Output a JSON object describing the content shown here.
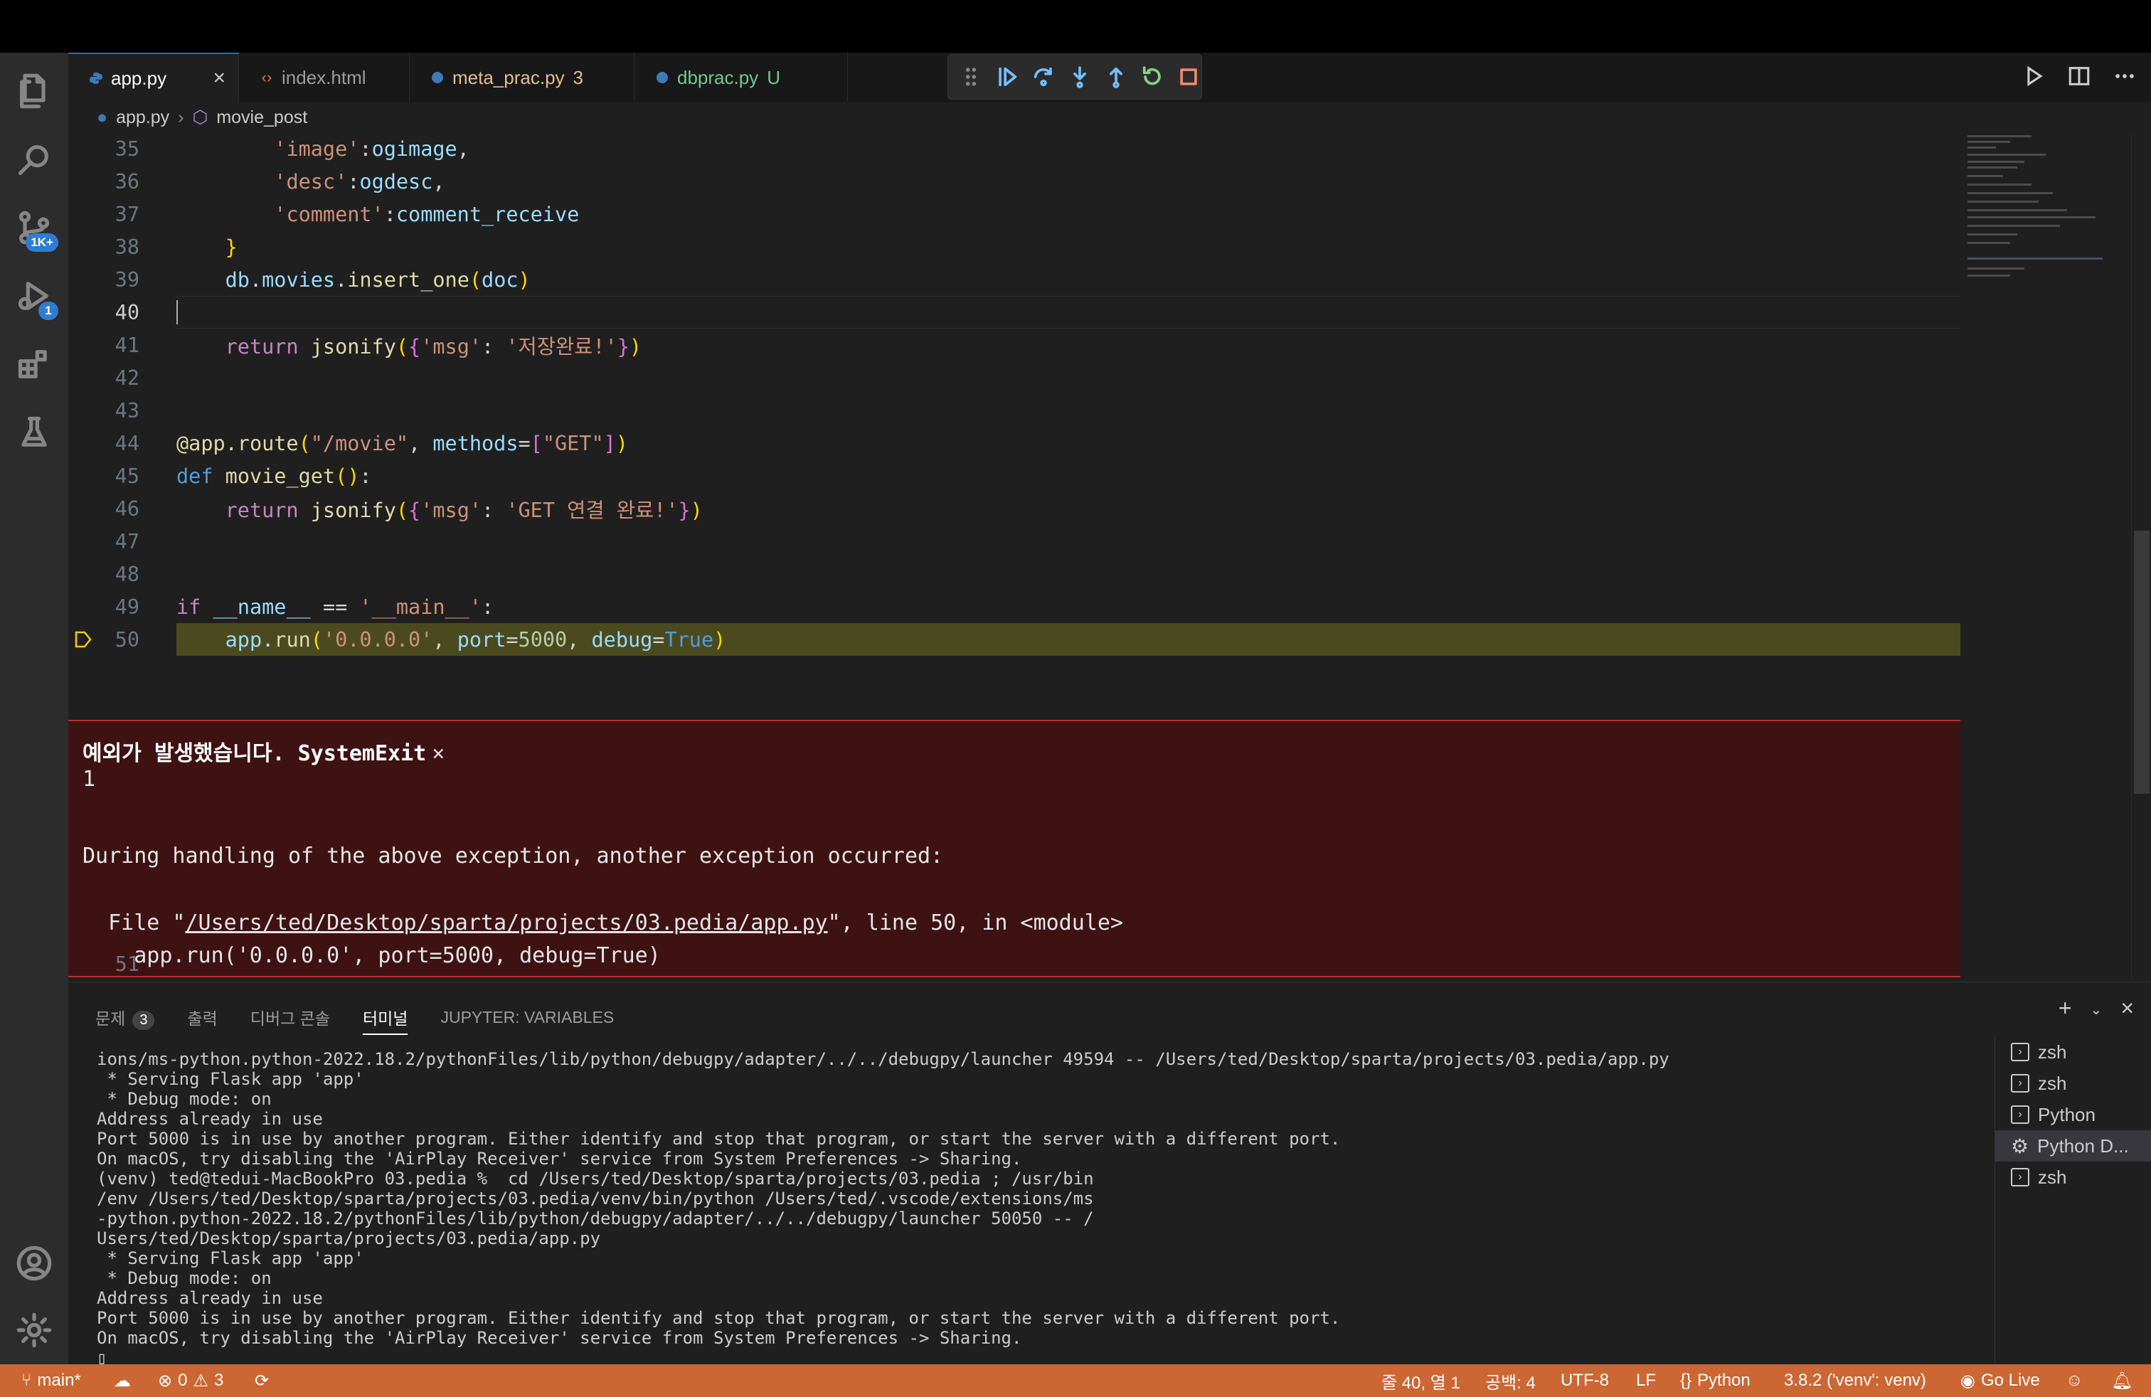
{
  "tabs": [
    {
      "label": "app.py",
      "meta": "",
      "active": true,
      "color": "#ffffff"
    },
    {
      "label": "index.html",
      "meta": ""
    },
    {
      "label": "meta_prac.py",
      "meta": "3",
      "color": "#e2c08d"
    },
    {
      "label": "dbprac.py",
      "meta": "U",
      "color": "#73c991"
    }
  ],
  "activity": {
    "source_control_badge": "1K+",
    "debug_badge": "1"
  },
  "breadcrumb": {
    "file": "app.py",
    "symbol": "movie_post"
  },
  "editor": {
    "line_numbers": [
      "35",
      "36",
      "37",
      "38",
      "39",
      "40",
      "41",
      "42",
      "43",
      "44",
      "45",
      "46",
      "47",
      "48",
      "49",
      "50",
      "51"
    ],
    "current_line": "40"
  },
  "exception": {
    "title": "예외가 발생했습니다. SystemExit",
    "close": "×",
    "code": "1",
    "during": "During handling of the above exception, another exception occurred:",
    "file_prefix": "  File \"",
    "file_path": "/Users/ted/Desktop/sparta/projects/03.pedia/app.py",
    "file_suffix": "\", line 50, in <module>",
    "source": "    app.run('0.0.0.0', port=5000, debug=True)"
  },
  "panel": {
    "tabs": [
      {
        "label": "문제",
        "count": "3"
      },
      {
        "label": "출력"
      },
      {
        "label": "디버그 콘솔"
      },
      {
        "label": "터미널",
        "active": true
      },
      {
        "label": "JUPYTER: VARIABLES"
      }
    ],
    "terminal": "ions/ms-python.python-2022.18.2/pythonFiles/lib/python/debugpy/adapter/../../debugpy/launcher 49594 -- /Users/ted/Desktop/sparta/projects/03.pedia/app.py\n * Serving Flask app 'app'\n * Debug mode: on\nAddress already in use\nPort 5000 is in use by another program. Either identify and stop that program, or start the server with a different port.\nOn macOS, try disabling the 'AirPlay Receiver' service from System Preferences -> Sharing.\n(venv) ted@tedui-MacBookPro 03.pedia %  cd /Users/ted/Desktop/sparta/projects/03.pedia ; /usr/bin\n/env /Users/ted/Desktop/sparta/projects/03.pedia/venv/bin/python /Users/ted/.vscode/extensions/ms\n-python.python-2022.18.2/pythonFiles/lib/python/debugpy/adapter/../../debugpy/launcher 50050 -- /\nUsers/ted/Desktop/sparta/projects/03.pedia/app.py\n * Serving Flask app 'app'\n * Debug mode: on\nAddress already in use\nPort 5000 is in use by another program. Either identify and stop that program, or start the server with a different port.\nOn macOS, try disabling the 'AirPlay Receiver' service from System Preferences -> Sharing.\n▯",
    "terminals": [
      "zsh",
      "zsh",
      "Python",
      "Python D...",
      "zsh"
    ]
  },
  "status": {
    "branch": "main*",
    "errors": "0",
    "warnings": "3",
    "position": "줄 40, 열 1",
    "spaces": "공백: 4",
    "encoding": "UTF-8",
    "eol": "LF",
    "language": "Python",
    "interpreter": "3.8.2 ('venv': venv)",
    "golive": "Go Live"
  },
  "colors": {
    "status_bg": "#cc6633",
    "exception_bg": "#3e1212",
    "accent": "#0078d4"
  }
}
